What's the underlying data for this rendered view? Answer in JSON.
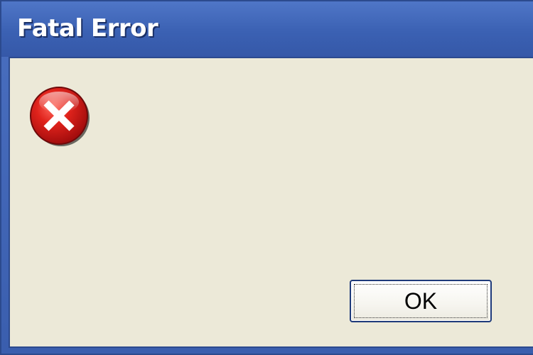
{
  "window": {
    "title": "Fatal Error"
  },
  "dialog": {
    "icon": "error-icon",
    "ok_label": "OK"
  },
  "colors": {
    "titlebar": "#3b61b3",
    "client_background": "#ece9d8",
    "error_red": "#d81e1e"
  }
}
